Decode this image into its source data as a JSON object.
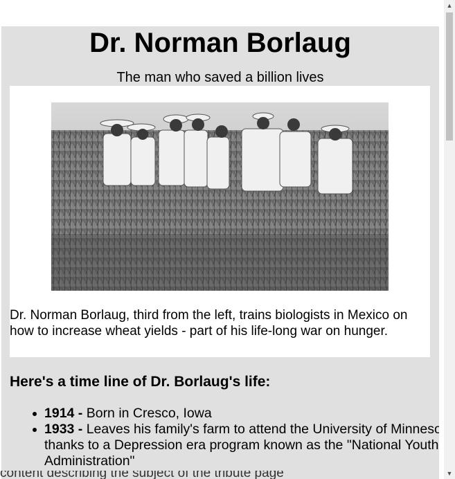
{
  "header": {
    "title": "Dr. Norman Borlaug",
    "subtitle": "The man who saved a billion lives"
  },
  "image": {
    "caption": "Dr. Norman Borlaug, third from the left, trains biologists in Mexico on how to increase wheat yields - part of his life-long war on hunger."
  },
  "timeline": {
    "heading": "Here's a time line of Dr. Borlaug's life:",
    "items": [
      {
        "year": "1914 -",
        "text": " Born in Cresco, Iowa"
      },
      {
        "year": "1933 -",
        "text": " Leaves his family's farm to attend the University of Minnesota, thanks to a Depression era program known as the \"National Youth Administration\""
      }
    ]
  },
  "footer": {
    "text": "content describing the subject of the tribute page"
  }
}
